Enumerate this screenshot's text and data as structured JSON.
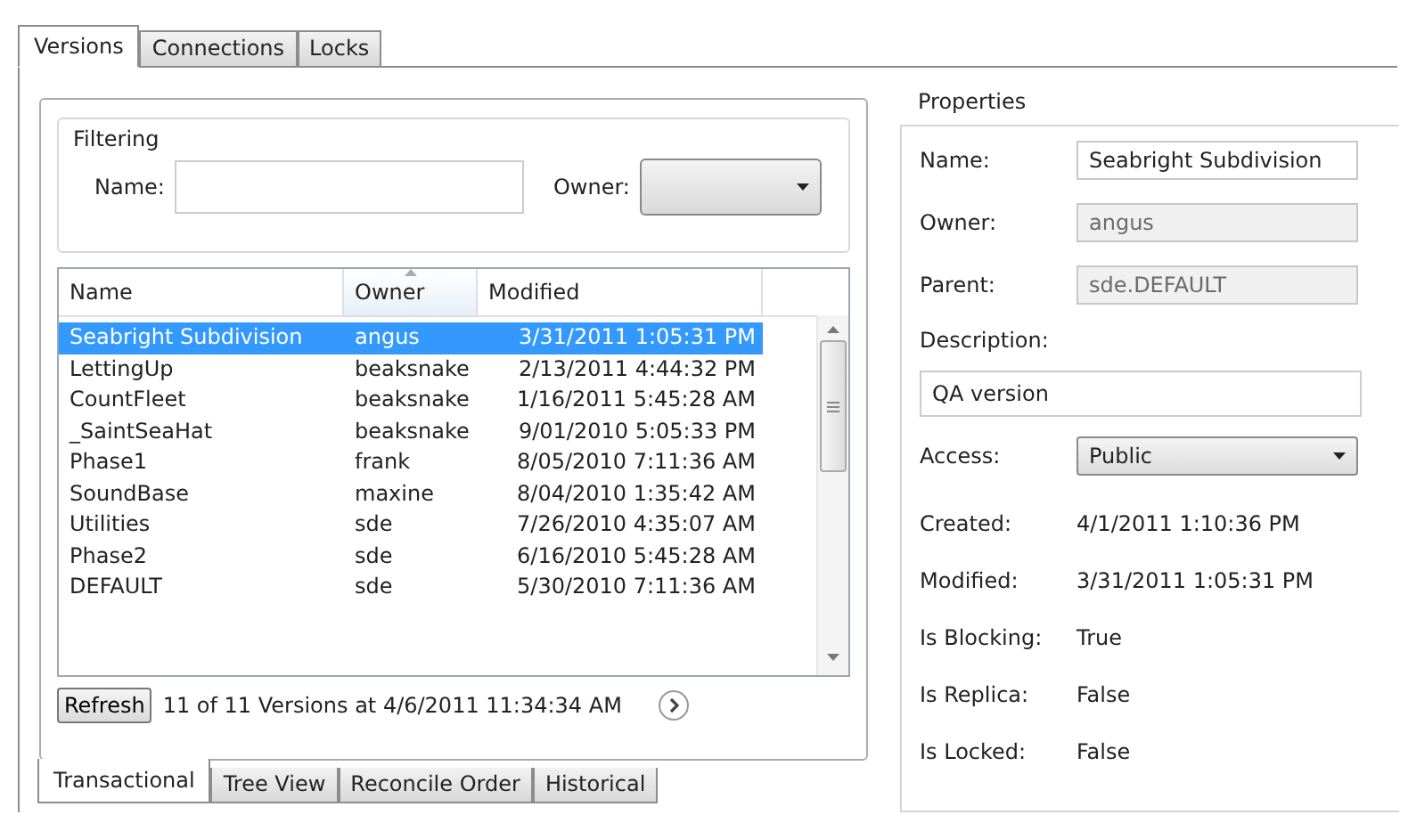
{
  "tabs": [
    {
      "label": "Versions",
      "selected": true
    },
    {
      "label": "Connections",
      "selected": false
    },
    {
      "label": "Locks",
      "selected": false
    }
  ],
  "filtering": {
    "title": "Filtering",
    "name_label": "Name:",
    "owner_label": "Owner:"
  },
  "table": {
    "columns": [
      {
        "label": "Name",
        "sorted": false
      },
      {
        "label": "Owner",
        "sorted": true
      },
      {
        "label": "Modified",
        "sorted": false
      }
    ],
    "rows": [
      {
        "name": "Seabright Subdivision",
        "owner": "angus",
        "modified": "3/31/2011 1:05:31 PM",
        "selected": true
      },
      {
        "name": "LettingUp",
        "owner": "beaksnake",
        "modified": "2/13/2011 4:44:32 PM",
        "selected": false
      },
      {
        "name": "CountFleet",
        "owner": "beaksnake",
        "modified": "1/16/2011 5:45:28 AM",
        "selected": false
      },
      {
        "name": "_SaintSeaHat",
        "owner": "beaksnake",
        "modified": "9/01/2010 5:05:33 PM",
        "selected": false
      },
      {
        "name": "Phase1",
        "owner": "frank",
        "modified": "8/05/2010 7:11:36 AM",
        "selected": false
      },
      {
        "name": "SoundBase",
        "owner": "maxine",
        "modified": "8/04/2010 1:35:42 AM",
        "selected": false
      },
      {
        "name": "Utilities",
        "owner": "sde",
        "modified": "7/26/2010 4:35:07 AM",
        "selected": false
      },
      {
        "name": "Phase2",
        "owner": "sde",
        "modified": "6/16/2010 5:45:28 AM",
        "selected": false
      },
      {
        "name": "DEFAULT",
        "owner": "sde",
        "modified": "5/30/2010 7:11:36 AM",
        "selected": false
      }
    ]
  },
  "refresh_button": "Refresh",
  "status": "11 of 11 Versions at 4/6/2011 11:34:34 AM",
  "view_tabs": [
    {
      "label": "Transactional",
      "selected": true
    },
    {
      "label": "Tree View",
      "selected": false
    },
    {
      "label": "Reconcile Order",
      "selected": false
    },
    {
      "label": "Historical",
      "selected": false
    }
  ],
  "properties": {
    "title": "Properties",
    "fields": [
      {
        "label": "Name:",
        "value": "Seabright Subdivision",
        "disabled": false
      },
      {
        "label": "Owner:",
        "value": "angus",
        "disabled": true
      },
      {
        "label": "Parent:",
        "value": "sde.DEFAULT",
        "disabled": true
      }
    ],
    "description_label": "Description:",
    "description": "QA version",
    "access_label": "Access:",
    "access": "Public",
    "info": [
      {
        "label": "Created:",
        "value": "4/1/2011 1:10:36 PM"
      },
      {
        "label": "Modified:",
        "value": "3/31/2011 1:05:31 PM"
      },
      {
        "label": "Is Blocking:",
        "value": "True"
      },
      {
        "label": "Is Replica:",
        "value": "False"
      },
      {
        "label": "Is Locked:",
        "value": "False"
      }
    ]
  }
}
